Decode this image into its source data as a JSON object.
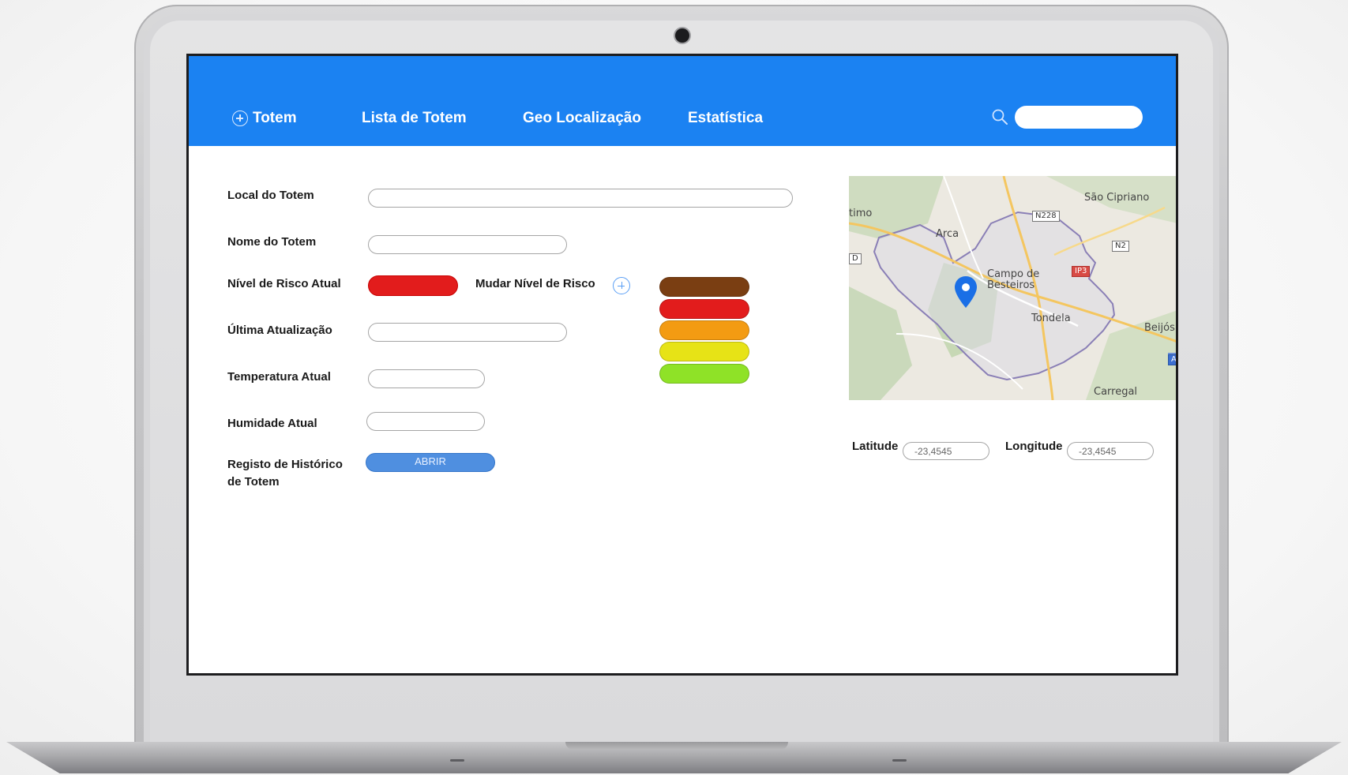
{
  "navbar": {
    "items": [
      {
        "label": "Totem"
      },
      {
        "label": "Lista de Totem"
      },
      {
        "label": "Geo Localização"
      },
      {
        "label": "Estatística"
      }
    ],
    "search": {
      "value": "",
      "placeholder": ""
    },
    "color": "#1b82f2"
  },
  "form": {
    "local_label": "Local do Totem",
    "local_value": "",
    "nome_label": "Nome do Totem",
    "nome_value": "",
    "risco_label": "Nível de Risco Atual",
    "risco_color": "#e21c1c",
    "mudar_label": "Mudar Nível de Risco",
    "ultima_label": "Última Atualização",
    "ultima_value": "",
    "temperatura_label": "Temperatura Atual",
    "temperatura_value": "",
    "humidade_label": "Humidade Atual",
    "humidade_value": "",
    "registo_label_line1": "Registo de Histórico",
    "registo_label_line2": "de Totem",
    "abrir_label": "ABRIR"
  },
  "risk_levels": [
    {
      "color": "#7a3e12"
    },
    {
      "color": "#e21c1c"
    },
    {
      "color": "#f39b12"
    },
    {
      "color": "#e7e316"
    },
    {
      "color": "#8fe227"
    }
  ],
  "map": {
    "places": {
      "sao_cipriano": "São Cipriano",
      "timo": "timo",
      "arca": "Arca",
      "campo_de_besteiros": "Campo de Besteiros",
      "tondela": "Tondela",
      "beijos": "Beijós",
      "carregal": "Carregal"
    },
    "roads": {
      "n228": "N228",
      "n2": "N2",
      "ip3": "IP3",
      "a": "A",
      "box": "D"
    }
  },
  "coordinates": {
    "latitude_label": "Latitude",
    "latitude_value": "-23,4545",
    "longitude_label": "Longitude",
    "longitude_value": "-23,4545"
  }
}
